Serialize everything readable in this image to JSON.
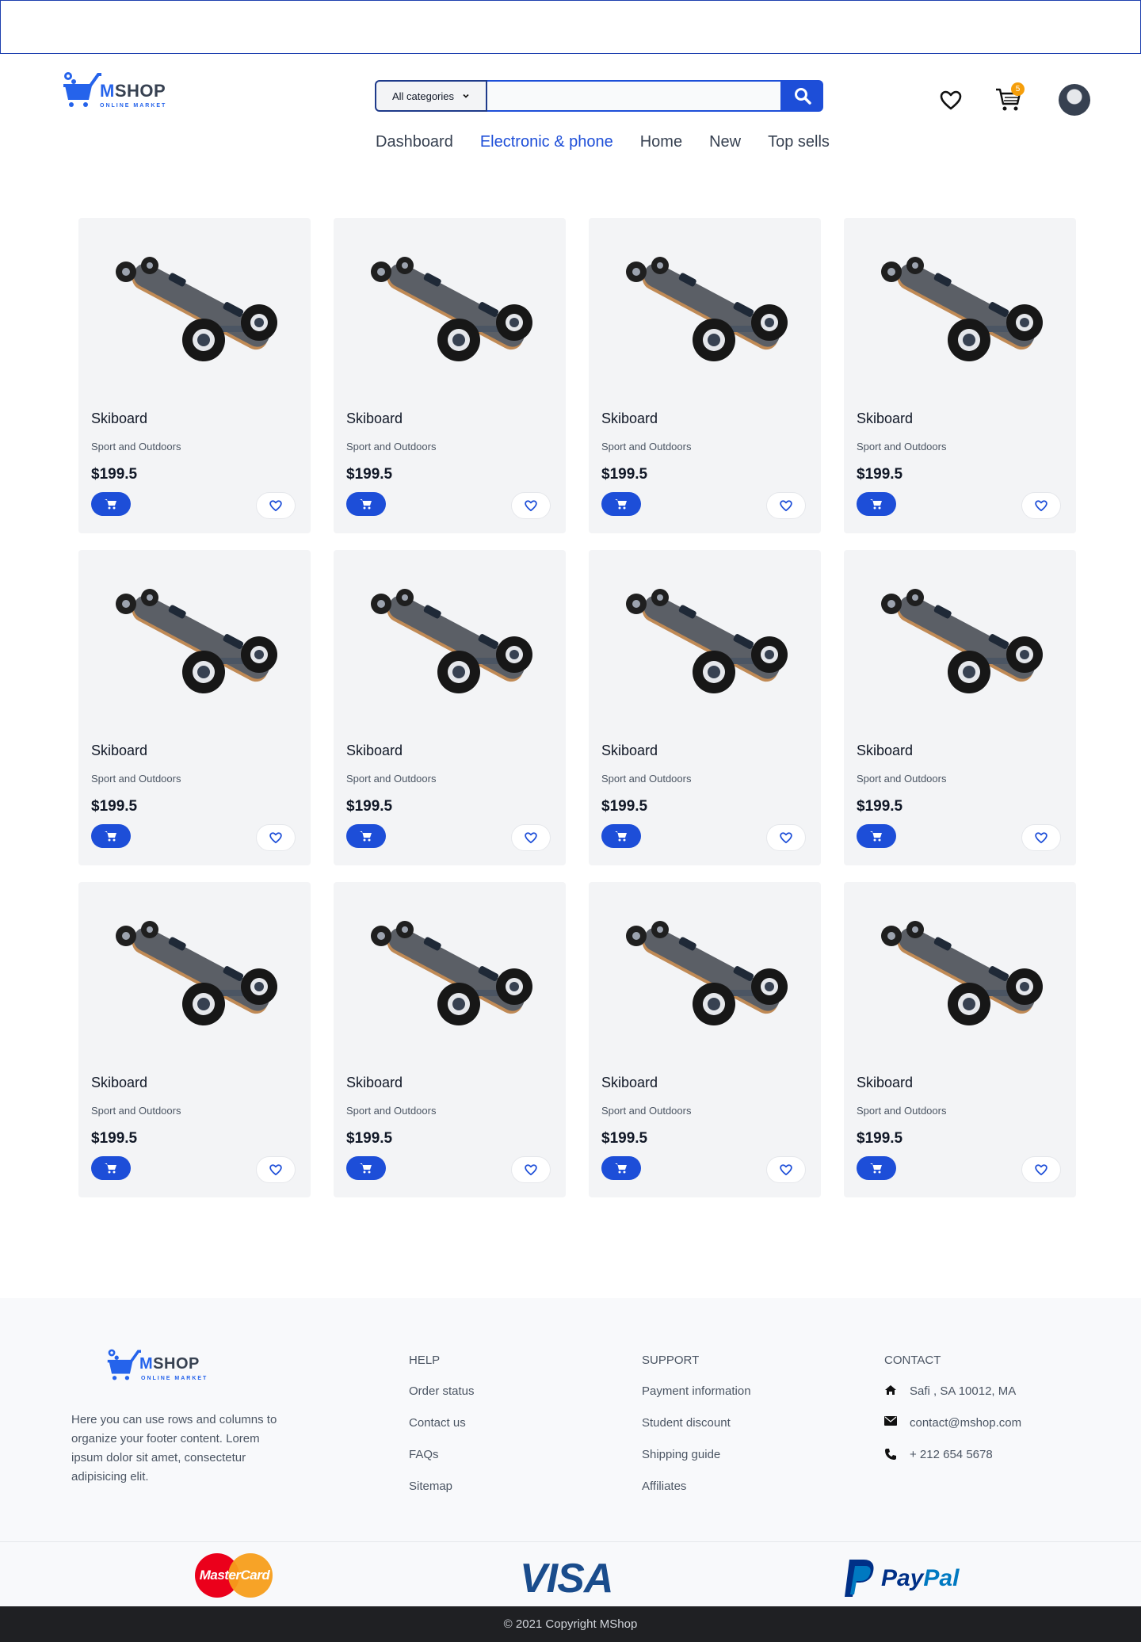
{
  "brand": {
    "name_m": "M",
    "name_rest": "SHOP",
    "tagline": "ONLINE MARKET"
  },
  "search": {
    "category": "All categories",
    "placeholder": ""
  },
  "nav": [
    "Dashboard",
    "Electronic & phone",
    "Home",
    "New",
    "Top sells"
  ],
  "nav_active": "Electronic & phone",
  "cart_count": "5",
  "products": [
    {
      "name": "Skiboard",
      "category": "Sport and Outdoors",
      "price": "$199.5"
    },
    {
      "name": "Skiboard",
      "category": "Sport and Outdoors",
      "price": "$199.5"
    },
    {
      "name": "Skiboard",
      "category": "Sport and Outdoors",
      "price": "$199.5"
    },
    {
      "name": "Skiboard",
      "category": "Sport and Outdoors",
      "price": "$199.5"
    },
    {
      "name": "Skiboard",
      "category": "Sport and Outdoors",
      "price": "$199.5"
    },
    {
      "name": "Skiboard",
      "category": "Sport and Outdoors",
      "price": "$199.5"
    },
    {
      "name": "Skiboard",
      "category": "Sport and Outdoors",
      "price": "$199.5"
    },
    {
      "name": "Skiboard",
      "category": "Sport and Outdoors",
      "price": "$199.5"
    },
    {
      "name": "Skiboard",
      "category": "Sport and Outdoors",
      "price": "$199.5"
    },
    {
      "name": "Skiboard",
      "category": "Sport and Outdoors",
      "price": "$199.5"
    },
    {
      "name": "Skiboard",
      "category": "Sport and Outdoors",
      "price": "$199.5"
    },
    {
      "name": "Skiboard",
      "category": "Sport and Outdoors",
      "price": "$199.5"
    }
  ],
  "footer": {
    "description": "Here you can use rows and columns to organize your footer content. Lorem ipsum dolor sit amet, consectetur adipisicing elit.",
    "help": {
      "title": "HELP",
      "links": [
        "Order status",
        "Contact us",
        "FAQs",
        "Sitemap"
      ]
    },
    "support": {
      "title": "SUPPORT",
      "links": [
        "Payment information",
        "Student discount",
        "Shipping guide",
        "Affiliates"
      ]
    },
    "contact": {
      "title": "CONTACT",
      "address": "Safi , SA 10012, MA",
      "email": "contact@mshop.com",
      "phone": "+ 212 654 5678"
    },
    "payments": {
      "mastercard": "MasterCard",
      "visa": "VISA",
      "paypal_pay": "Pay",
      "paypal_pal": "Pal"
    },
    "copyright": "© 2021 Copyright MShop"
  },
  "colors": {
    "primary": "#1d4ed8",
    "badge": "#f59e0b",
    "footer_dark": "#1f2023"
  },
  "icons": [
    "search-icon",
    "heart-icon",
    "cart-icon",
    "chevron-down-icon",
    "home-icon",
    "envelope-icon",
    "phone-icon"
  ]
}
